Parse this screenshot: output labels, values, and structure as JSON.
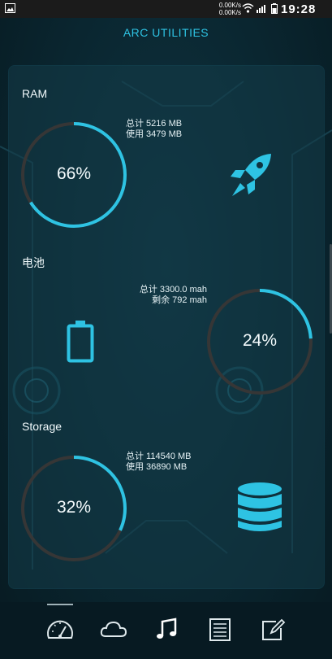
{
  "status_bar": {
    "speed_up": "0.00K/s",
    "speed_down": "0.00K/s",
    "time": "19:28",
    "icons": [
      "image-icon",
      "wifi-icon",
      "signal-icon",
      "battery-icon"
    ]
  },
  "app": {
    "title": "ARC UTILITIES"
  },
  "ram": {
    "label": "RAM",
    "total_line": "总计 5216 MB",
    "used_line": "使用 3479 MB",
    "percent_text": "66%",
    "percent": 0.66,
    "icon": "rocket-icon"
  },
  "battery": {
    "label": "电池",
    "total_line": "总计 3300.0 mah",
    "remaining_line": "剩余 792 mah",
    "percent_text": "24%",
    "percent": 0.24,
    "icon": "battery-icon"
  },
  "storage": {
    "label": "Storage",
    "total_line": "总计 114540 MB",
    "used_line": "使用 36890 MB",
    "percent_text": "32%",
    "percent": 0.32,
    "icon": "database-icon"
  },
  "tabs": [
    "speedometer-icon",
    "cloud-icon",
    "music-icon",
    "news-icon",
    "edit-icon"
  ],
  "colors": {
    "accent": "#2ec3e3",
    "track": "#3a3a3a",
    "background": "#0a2630"
  }
}
